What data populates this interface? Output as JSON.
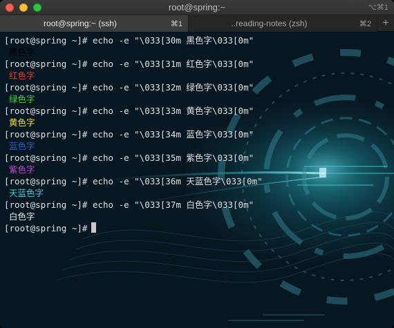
{
  "window": {
    "title": "root@spring:~",
    "shortcut": "⌥⌘1"
  },
  "tabs": [
    {
      "label": "root@spring:~ (ssh)",
      "shortcut": "⌘1",
      "active": true
    },
    {
      "label": "..reading-notes (zsh)",
      "shortcut": "⌘2",
      "active": false
    }
  ],
  "new_tab_label": "+",
  "terminal": {
    "prompt": "[root@spring ~]#",
    "entries": [
      {
        "command": "echo -e \"\\033[30m 黑色字\\033[0m\"",
        "output": "黑色字",
        "color": "#000000"
      },
      {
        "command": "echo -e \"\\033[31m 红色字\\033[0m\"",
        "output": "红色字",
        "color": "#e8362b"
      },
      {
        "command": "echo -e \"\\033[32m 绿色字\\033[0m\"",
        "output": "绿色字",
        "color": "#3fd63f"
      },
      {
        "command": "echo -e \"\\033[33m 黄色字\\033[0m\"",
        "output": "黄色字",
        "color": "#e8e03a"
      },
      {
        "command": "echo -e \"\\033[34m 蓝色字\\033[0m\"",
        "output": "蓝色字",
        "color": "#2b5bd8"
      },
      {
        "command": "echo -e \"\\033[35m 紫色字\\033[0m\"",
        "output": "紫色字",
        "color": "#d23dd8"
      },
      {
        "command": "echo -e \"\\033[36m 天蓝色字\\033[0m\"",
        "output": "天蓝色字",
        "color": "#33cfd8"
      },
      {
        "command": "echo -e \"\\033[37m 白色字\\033[0m\"",
        "output": "白色字",
        "color": "#e6e6e6"
      }
    ],
    "final_prompt": "[root@spring ~]#"
  }
}
